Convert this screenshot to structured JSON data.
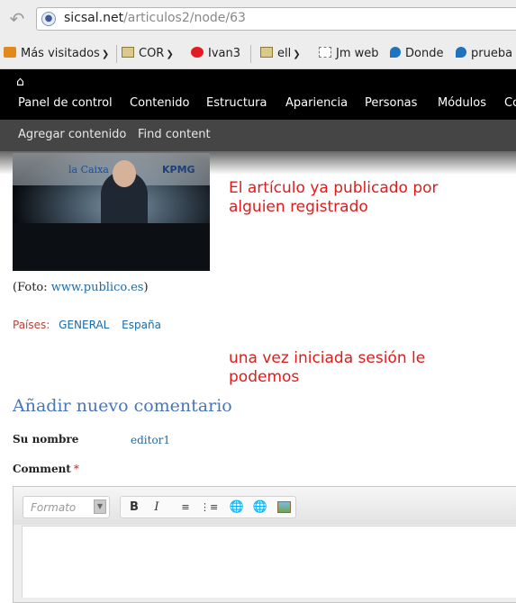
{
  "browser": {
    "url_host": "sicsal.net",
    "url_path": "/articulos2/node/63"
  },
  "bookmarks": [
    {
      "label": "Más visitados",
      "icon": "rss-icon"
    },
    {
      "label": "COR",
      "icon": "folder-icon"
    },
    {
      "label": "Ivan3",
      "icon": "red-circle-icon"
    },
    {
      "label": "ell",
      "icon": "folder-icon"
    },
    {
      "label": "Jm web",
      "icon": "page-icon"
    },
    {
      "label": "Donde",
      "icon": "drupal-icon"
    },
    {
      "label": "prueba",
      "icon": "drupal-icon"
    }
  ],
  "admin_toolbar": {
    "items": [
      "Panel de control",
      "Contenido",
      "Estructura",
      "Apariencia",
      "Personas",
      "Módulos",
      "Co"
    ],
    "shortcuts": [
      "Agregar contenido",
      "Find content"
    ]
  },
  "article": {
    "caption_prefix": "(Foto: ",
    "caption_link": "www.publico.es",
    "caption_suffix": ")",
    "countries_label": "Países:",
    "countries": [
      "GENERAL",
      "España"
    ]
  },
  "annotations": {
    "first": "El artículo ya publicado por alguien registrado",
    "second": "una vez iniciada sesión le podemos"
  },
  "comment_form": {
    "heading": "Añadir nuevo comentario",
    "name_label": "Su nombre",
    "name_value": "editor1",
    "comment_label": "Comment",
    "required_mark": "*",
    "format_placeholder": "Formato",
    "toolbar_buttons": [
      "bold-button",
      "italic-button",
      "numbered-list-button",
      "bulleted-list-button",
      "link-button",
      "unlink-button",
      "image-button"
    ]
  },
  "colors": {
    "toolbar_bg": "#000000",
    "shortcuts_bg": "#454545",
    "link": "#1a6aa8",
    "annotation": "#e01b1b",
    "heading": "#4a76b8"
  }
}
